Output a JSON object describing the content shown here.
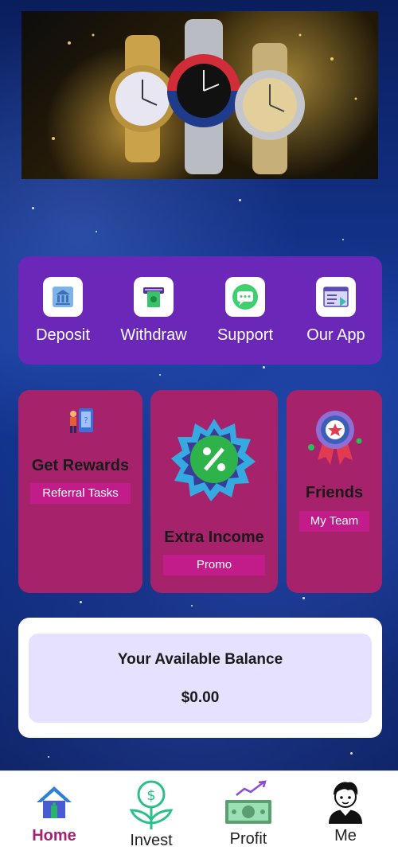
{
  "quick_actions": [
    {
      "label": "Deposit",
      "icon": "bank-icon"
    },
    {
      "label": "Withdraw",
      "icon": "atm-cash-icon"
    },
    {
      "label": "Support",
      "icon": "chat-icon"
    },
    {
      "label": "Our App",
      "icon": "app-window-icon"
    }
  ],
  "cards": {
    "rewards": {
      "title": "Get Rewards",
      "button": "Referral Tasks"
    },
    "income": {
      "title": "Extra Income",
      "button": "Promo"
    },
    "friends": {
      "title": "Friends",
      "button": "My Team"
    }
  },
  "balance": {
    "title": "Your Available Balance",
    "amount": "$0.00"
  },
  "nav": [
    {
      "label": "Home",
      "icon": "home-icon",
      "active": true
    },
    {
      "label": "Invest",
      "icon": "money-plant-icon",
      "active": false
    },
    {
      "label": "Profit",
      "icon": "profit-chart-icon",
      "active": false
    },
    {
      "label": "Me",
      "icon": "user-avatar-icon",
      "active": false
    }
  ],
  "colors": {
    "accent_purple": "#6a27b8",
    "card_magenta": "#a6236c",
    "pill_pink": "#c21c8a",
    "active_nav": "#a32370",
    "balance_bg": "#e5e1ff"
  }
}
